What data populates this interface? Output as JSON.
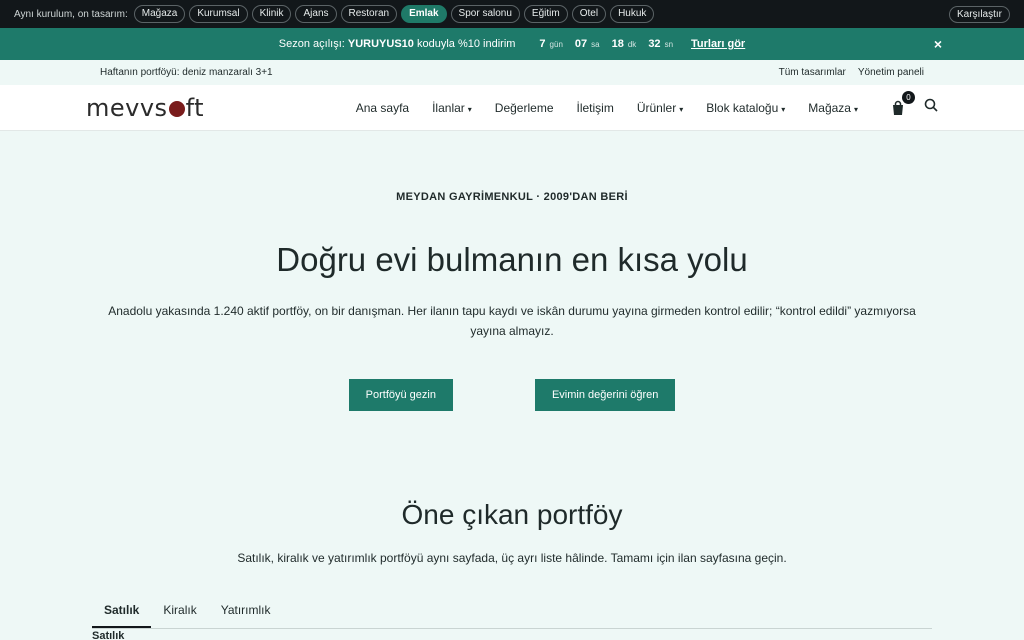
{
  "topbar": {
    "label": "Aynı kurulum, on tasarım:",
    "pills": [
      "Mağaza",
      "Kurumsal",
      "Klinik",
      "Ajans",
      "Restoran",
      "Emlak",
      "Spor salonu",
      "Eğitim",
      "Otel",
      "Hukuk"
    ],
    "active_pill": "Emlak",
    "compare": "Karşılaştır"
  },
  "promo": {
    "prefix": "Sezon açılışı:",
    "code": "YURUYUS10",
    "suffix": "koduyla %10 indirim",
    "countdown": [
      {
        "value": "7",
        "unit": "gün"
      },
      {
        "value": "07",
        "unit": "sa"
      },
      {
        "value": "18",
        "unit": "dk"
      },
      {
        "value": "32",
        "unit": "sn"
      }
    ],
    "link": "Turları gör",
    "close": "×"
  },
  "utility": {
    "left": "Haftanın portföyü: deniz manzaralı 3+1",
    "links": [
      "Tüm tasarımlar",
      "Yönetim paneli"
    ]
  },
  "nav": {
    "logo_pre": "mevvs",
    "logo_post": "ft",
    "items": [
      {
        "label": "Ana sayfa",
        "caret": false
      },
      {
        "label": "İlanlar",
        "caret": true
      },
      {
        "label": "Değerleme",
        "caret": false
      },
      {
        "label": "İletişim",
        "caret": false
      },
      {
        "label": "Ürünler",
        "caret": true
      },
      {
        "label": "Blok kataloğu",
        "caret": true
      },
      {
        "label": "Mağaza",
        "caret": true
      }
    ],
    "cart_count": "0"
  },
  "hero": {
    "eyebrow": "MEYDAN GAYRİMENKUL · 2009'DAN BERİ",
    "title": "Doğru evi bulmanın en kısa yolu",
    "text": "Anadolu yakasında 1.240 aktif portföy, on bir danışman. Her ilanın tapu kaydı ve iskân durumu yayına girmeden kontrol edilir; “kontrol edildi” yazmıyorsa yayına almayız.",
    "primary_cta": "Portföyü gezin",
    "secondary_cta": "Evimin değerini öğren"
  },
  "featured": {
    "title": "Öne çıkan portföy",
    "text": "Satılık, kiralık ve yatırımlık portföyü aynı sayfada, üç ayrı liste hâlinde. Tamamı için ilan sayfasına geçin.",
    "tabs": [
      "Satılık",
      "Kiralık",
      "Yatırımlık"
    ],
    "section_label": "Satılık"
  }
}
